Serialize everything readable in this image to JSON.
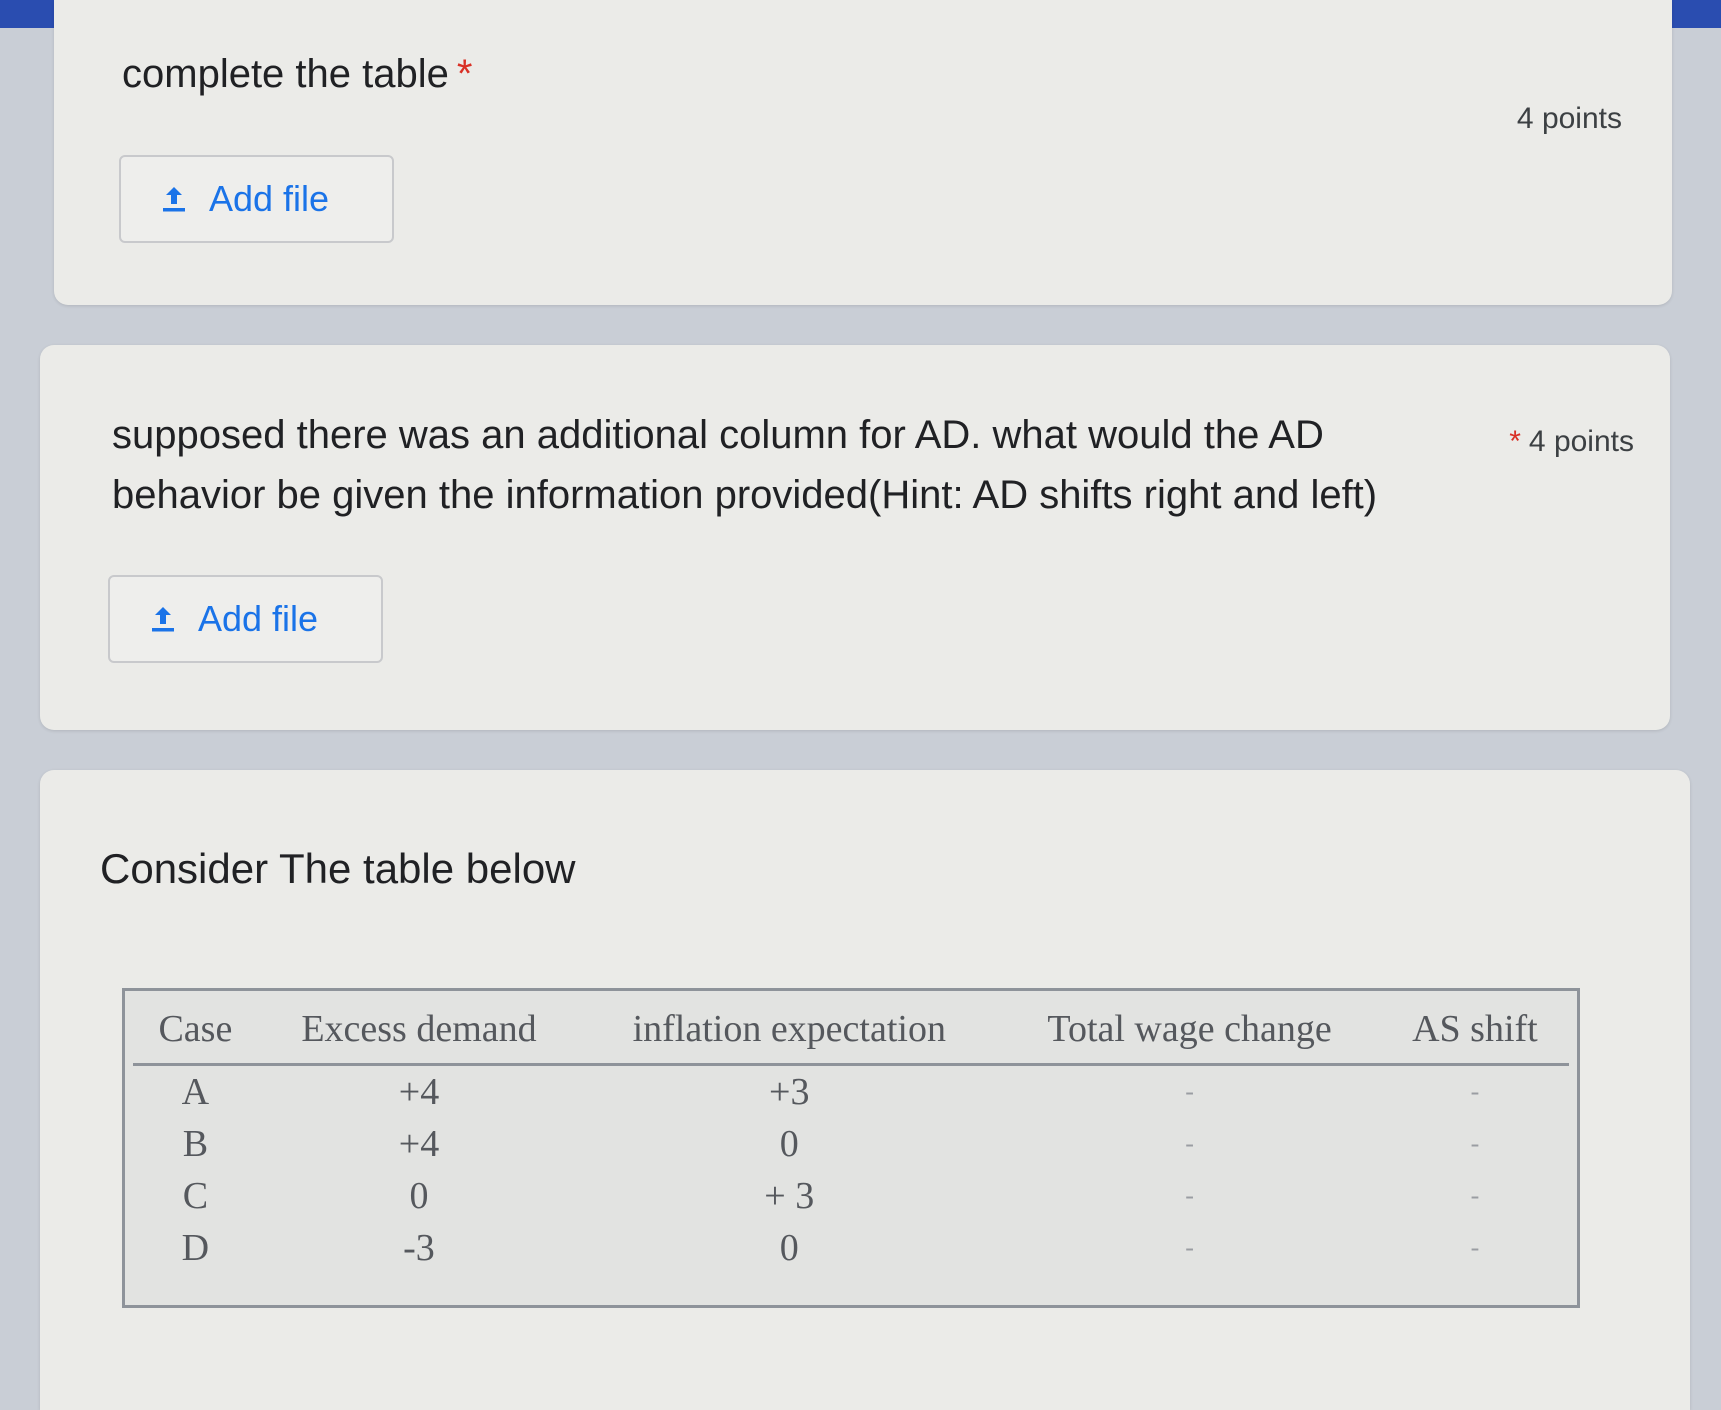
{
  "questions": [
    {
      "text": "complete the table",
      "required_mark": "*",
      "points": "4 points",
      "add_file_label": "Add file"
    },
    {
      "text": "supposed there was an additional column for AD. what would the AD behavior be given the information provided(Hint: AD shifts right and left)",
      "required_mark": "*",
      "points": "4 points",
      "add_file_label": "Add file"
    }
  ],
  "section": {
    "title": "Consider The table below",
    "table": {
      "headers": [
        "Case",
        "Excess demand",
        "inflation expectation",
        "Total wage change",
        "AS shift"
      ],
      "rows": [
        [
          "A",
          "+4",
          "+3",
          "-",
          "-"
        ],
        [
          "B",
          "+4",
          "0",
          "-",
          "-"
        ],
        [
          "C",
          "0",
          "+ 3",
          "-",
          "-"
        ],
        [
          "D",
          "-3",
          "0",
          "-",
          "-"
        ]
      ]
    }
  },
  "icons": {
    "upload": "upload-icon"
  },
  "colors": {
    "accent": "#1a73e8",
    "required": "#d93025",
    "top_bar": "#2a4db0"
  }
}
